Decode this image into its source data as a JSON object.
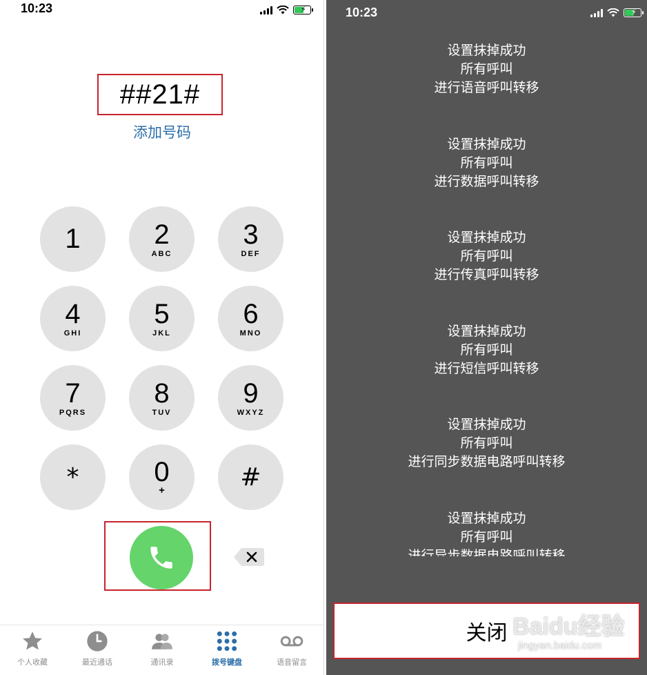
{
  "left": {
    "status_time": "10:23",
    "dialed_number": "##21#",
    "add_number_label": "添加号码",
    "keys": [
      {
        "digit": "1",
        "letters": ""
      },
      {
        "digit": "2",
        "letters": "ABC"
      },
      {
        "digit": "3",
        "letters": "DEF"
      },
      {
        "digit": "4",
        "letters": "GHI"
      },
      {
        "digit": "5",
        "letters": "JKL"
      },
      {
        "digit": "6",
        "letters": "MNO"
      },
      {
        "digit": "7",
        "letters": "PQRS"
      },
      {
        "digit": "8",
        "letters": "TUV"
      },
      {
        "digit": "9",
        "letters": "WXYZ"
      },
      {
        "digit": "*",
        "letters": ""
      },
      {
        "digit": "0",
        "letters": "+"
      },
      {
        "digit": "#",
        "letters": ""
      }
    ],
    "tabs": [
      {
        "label": "个人收藏",
        "icon": "star-icon"
      },
      {
        "label": "最近通话",
        "icon": "clock-icon"
      },
      {
        "label": "通讯录",
        "icon": "contacts-icon"
      },
      {
        "label": "拨号键盘",
        "icon": "keypad-icon",
        "active": true
      },
      {
        "label": "语音留言",
        "icon": "voicemail-icon"
      }
    ],
    "accent_color": "#2b6ea8",
    "call_color": "#65d46a",
    "highlight_color": "#c8232c"
  },
  "right": {
    "status_time": "10:23",
    "messages": [
      [
        "设置抹掉成功",
        "所有呼叫",
        "进行语音呼叫转移"
      ],
      [
        "设置抹掉成功",
        "所有呼叫",
        "进行数据呼叫转移"
      ],
      [
        "设置抹掉成功",
        "所有呼叫",
        "进行传真呼叫转移"
      ],
      [
        "设置抹掉成功",
        "所有呼叫",
        "进行短信呼叫转移"
      ],
      [
        "设置抹掉成功",
        "所有呼叫",
        "进行同步数据电路呼叫转移"
      ],
      [
        "设置抹掉成功",
        "所有呼叫",
        "进行异步数据电路呼叫转移"
      ]
    ],
    "close_label": "关闭",
    "watermark_main": "Baidu经验",
    "watermark_sub": "jingyan.baidu.com",
    "background_color": "#555555"
  }
}
